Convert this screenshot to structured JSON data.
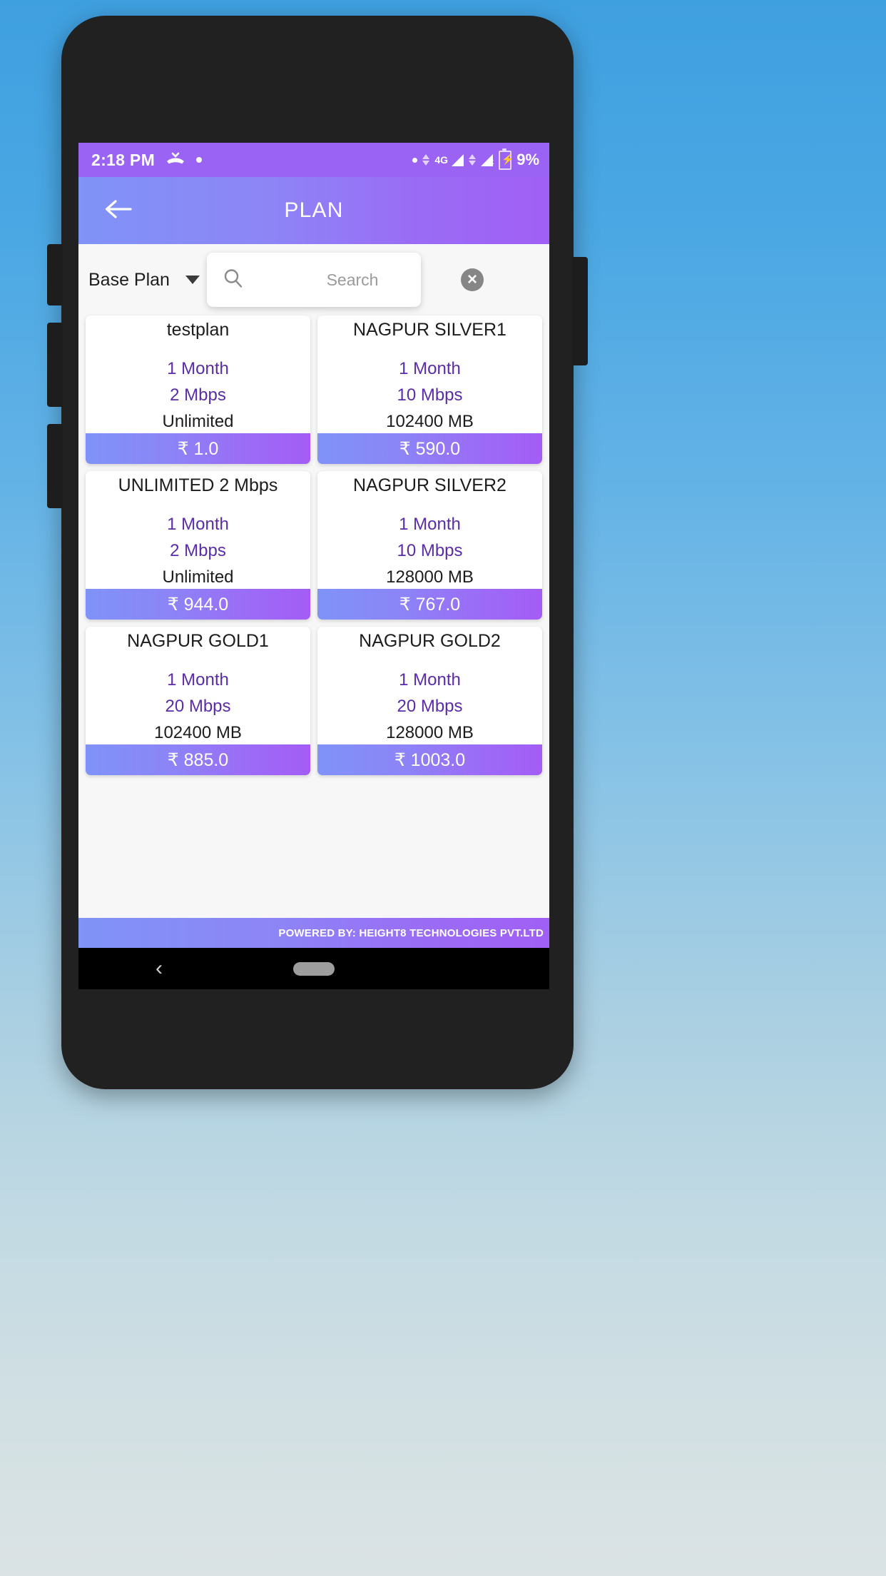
{
  "status_bar": {
    "time": "2:18 PM",
    "missed_call_icon": "missed-call-icon",
    "notification_dot": "notification-dot",
    "network_label": "4G",
    "battery_percent": "9%"
  },
  "app_bar": {
    "back_icon": "back-arrow-icon",
    "title": "PLAN"
  },
  "filter": {
    "plan_type_label": "Base Plan",
    "dropdown_caret": "chevron-down-icon"
  },
  "search": {
    "search_icon": "search-icon",
    "placeholder": "Search",
    "value": "",
    "clear_icon": "close-circle-icon"
  },
  "plans": [
    {
      "name": "testplan",
      "validity": "1 Month",
      "speed": "2 Mbps",
      "data": "Unlimited",
      "price": "₹ 1.0"
    },
    {
      "name": "NAGPUR SILVER1",
      "validity": "1 Month",
      "speed": "10 Mbps",
      "data": "102400 MB",
      "price": "₹ 590.0"
    },
    {
      "name": "UNLIMITED 2 Mbps",
      "validity": "1 Month",
      "speed": "2 Mbps",
      "data": "Unlimited",
      "price": "₹ 944.0"
    },
    {
      "name": "NAGPUR SILVER2",
      "validity": "1 Month",
      "speed": "10 Mbps",
      "data": "128000 MB",
      "price": "₹ 767.0"
    },
    {
      "name": "NAGPUR GOLD1",
      "validity": "1 Month",
      "speed": "20 Mbps",
      "data": "102400 MB",
      "price": "₹ 885.0"
    },
    {
      "name": "NAGPUR GOLD2",
      "validity": "1 Month",
      "speed": "20 Mbps",
      "data": "128000 MB",
      "price": "₹ 1003.0"
    }
  ],
  "footer": {
    "text": "POWERED BY: HEIGHT8 TECHNOLOGIES PVT.LTD"
  },
  "nav_bar": {
    "back_icon": "nav-back-icon",
    "home_pill": "home-pill"
  },
  "colors": {
    "status_bar": "#9b63f4",
    "app_bar_start": "#8093f7",
    "app_bar_end": "#a15ff5",
    "accent_purple": "#5b2ca8",
    "card_bg": "#ffffff",
    "content_bg": "#f7f7f8"
  }
}
